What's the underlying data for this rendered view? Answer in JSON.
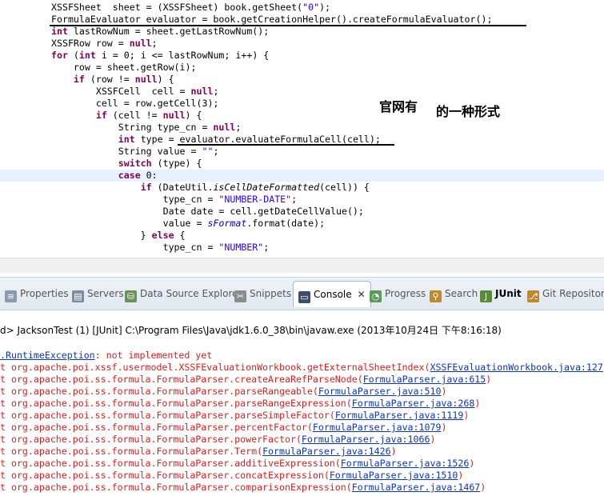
{
  "editor": {
    "lines": [
      {
        "parts": [
          {
            "t": "XSSFSheet  sheet = (XSSFSheet) book.getSheet("
          },
          {
            "t": "\"0\"",
            "c": "str"
          },
          {
            "t": ");"
          }
        ]
      },
      {
        "parts": [
          {
            "t": "FormulaEvaluator evaluator = book.getCreationHelper().createFormulaEvaluator();"
          }
        ]
      },
      {
        "parts": [
          {
            "t": "int",
            "c": "kw"
          },
          {
            "t": " lastRowNum = sheet.getLastRowNum();"
          }
        ]
      },
      {
        "parts": [
          {
            "t": "XSSFRow row = "
          },
          {
            "t": "null",
            "c": "kw"
          },
          {
            "t": ";"
          }
        ]
      },
      {
        "parts": [
          {
            "t": "for",
            "c": "kw"
          },
          {
            "t": " ("
          },
          {
            "t": "int",
            "c": "kw"
          },
          {
            "t": " i = 0; i <= lastRowNum; i++) {"
          }
        ]
      },
      {
        "parts": [
          {
            "t": "    row = sheet.getRow(i);"
          }
        ]
      },
      {
        "parts": [
          {
            "t": "    "
          },
          {
            "t": "if",
            "c": "kw"
          },
          {
            "t": " (row != "
          },
          {
            "t": "null",
            "c": "kw"
          },
          {
            "t": ") {"
          }
        ]
      },
      {
        "parts": [
          {
            "t": "        XSSFCell  cell = "
          },
          {
            "t": "null",
            "c": "kw"
          },
          {
            "t": ";"
          }
        ]
      },
      {
        "parts": [
          {
            "t": "        cell = row.getCell(3);"
          }
        ]
      },
      {
        "parts": [
          {
            "t": "        "
          },
          {
            "t": "if",
            "c": "kw"
          },
          {
            "t": " (cell != "
          },
          {
            "t": "null",
            "c": "kw"
          },
          {
            "t": ") {"
          }
        ]
      },
      {
        "parts": [
          {
            "t": "            String type_cn = "
          },
          {
            "t": "null",
            "c": "kw"
          },
          {
            "t": ";"
          }
        ]
      },
      {
        "parts": [
          {
            "t": "            "
          },
          {
            "t": "int",
            "c": "kw"
          },
          {
            "t": " type = evaluator.evaluateFormulaCell(cell);"
          }
        ]
      },
      {
        "parts": [
          {
            "t": "            String value = "
          },
          {
            "t": "\"\"",
            "c": "str"
          },
          {
            "t": ";"
          }
        ]
      },
      {
        "parts": [
          {
            "t": "            "
          },
          {
            "t": "switch",
            "c": "kw"
          },
          {
            "t": " (type) {"
          }
        ]
      },
      {
        "parts": [
          {
            "t": "            "
          },
          {
            "t": "case",
            "c": "kw"
          },
          {
            "t": " 0:"
          }
        ],
        "highlight": true
      },
      {
        "parts": [
          {
            "t": "                "
          },
          {
            "t": "if",
            "c": "kw"
          },
          {
            "t": " (DateUtil."
          },
          {
            "t": "isCellDateFormatted",
            "c": "st"
          },
          {
            "t": "(cell)) {"
          }
        ]
      },
      {
        "parts": [
          {
            "t": "                    type_cn = "
          },
          {
            "t": "\"NUMBER-DATE\"",
            "c": "str"
          },
          {
            "t": ";"
          }
        ]
      },
      {
        "parts": [
          {
            "t": "                    Date date = cell.getDateCellValue();"
          }
        ]
      },
      {
        "parts": [
          {
            "t": "                    value = "
          },
          {
            "t": "sFormat",
            "c": "fld"
          },
          {
            "t": ".format(date);"
          }
        ]
      },
      {
        "parts": [
          {
            "t": "                } "
          },
          {
            "t": "else",
            "c": "kw"
          },
          {
            "t": " {"
          }
        ]
      },
      {
        "parts": [
          {
            "t": "                    type_cn = "
          },
          {
            "t": "\"NUMBER\"",
            "c": "str"
          },
          {
            "t": ";"
          }
        ]
      }
    ],
    "annotation_left": "官网有",
    "annotation_right": "的一种形式"
  },
  "tabs": [
    {
      "label": "Properties",
      "icon": "properties-icon",
      "color": "#8a9bb0"
    },
    {
      "label": "Servers",
      "icon": "servers-icon",
      "color": "#7d8b9a"
    },
    {
      "label": "Data Source Explorer",
      "icon": "data-source-icon",
      "color": "#6a8f5a"
    },
    {
      "label": "Snippets",
      "icon": "snippets-icon",
      "color": "#8c8c8c"
    },
    {
      "label": "Console",
      "icon": "console-icon",
      "color": "#3b4f6b",
      "active": true
    },
    {
      "label": "Progress",
      "icon": "progress-icon",
      "color": "#5a9a5a"
    },
    {
      "label": "Search",
      "icon": "search-icon",
      "color": "#c08a2a"
    },
    {
      "label": "JUnit",
      "icon": "junit-icon",
      "color": "#5c8a3c"
    },
    {
      "label": "Git Repositories",
      "icon": "git-icon",
      "color": "#c0882a"
    }
  ],
  "console": {
    "header": "d> JacksonTest (1) [JUnit] C:\\Program Files\\Java\\jdk1.6.0_38\\bin\\javaw.exe (2013年10月24日 下午8:16:18)",
    "exception_link": ".RuntimeException",
    "exception_msg": ": not implemented yet",
    "frames": [
      {
        "text": "t org.apache.poi.xssf.usermodel.XSSFEvaluationWorkbook.getExternalSheetIndex(",
        "link": "XSSFEvaluationWorkbook.java:127"
      },
      {
        "text": "t org.apache.poi.ss.formula.FormulaParser.createAreaRefParseNode(",
        "link": "FormulaParser.java:615",
        "end": ")"
      },
      {
        "text": "t org.apache.poi.ss.formula.FormulaParser.parseRangeable(",
        "link": "FormulaParser.java:510",
        "end": ")"
      },
      {
        "text": "t org.apache.poi.ss.formula.FormulaParser.parseRangeExpression(",
        "link": "FormulaParser.java:268",
        "end": ")"
      },
      {
        "text": "t org.apache.poi.ss.formula.FormulaParser.parseSimpleFactor(",
        "link": "FormulaParser.java:1119",
        "end": ")"
      },
      {
        "text": "t org.apache.poi.ss.formula.FormulaParser.percentFactor(",
        "link": "FormulaParser.java:1079",
        "end": ")"
      },
      {
        "text": "t org.apache.poi.ss.formula.FormulaParser.powerFactor(",
        "link": "FormulaParser.java:1066",
        "end": ")"
      },
      {
        "text": "t org.apache.poi.ss.formula.FormulaParser.Term(",
        "link": "FormulaParser.java:1426",
        "end": ")"
      },
      {
        "text": "t org.apache.poi.ss.formula.FormulaParser.additiveExpression(",
        "link": "FormulaParser.java:1526",
        "end": ")"
      },
      {
        "text": "t org.apache.poi.ss.formula.FormulaParser.concatExpression(",
        "link": "FormulaParser.java:1510",
        "end": ")"
      },
      {
        "text": "t org.apache.poi.ss.formula.FormulaParser.comparisonExpression(",
        "link": "FormulaParser.java:1467",
        "end": ")"
      }
    ]
  }
}
